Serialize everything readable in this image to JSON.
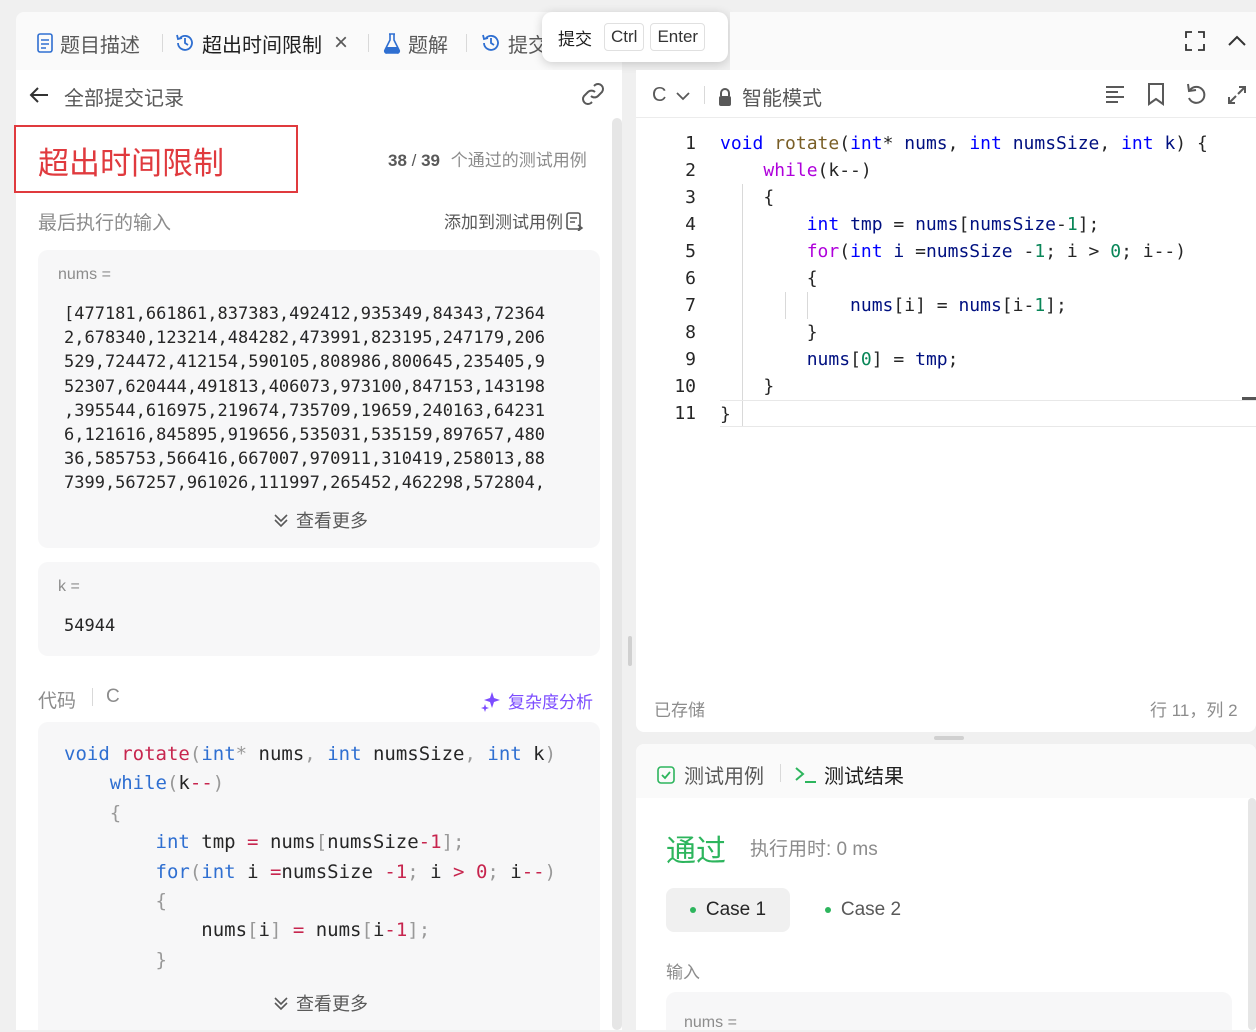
{
  "top_tabs": {
    "description": "题目描述",
    "tle": "超出时间限制",
    "solution": "题解",
    "submissions": "提交"
  },
  "submit_tooltip": {
    "label": "提交",
    "key1": "Ctrl",
    "key2": "Enter"
  },
  "left": {
    "back_label": "全部提交记录",
    "status": "超出时间限制",
    "passed": "38",
    "total": "39",
    "passed_suffix": "个通过的测试用例",
    "last_input_label": "最后执行的输入",
    "add_testcase": "添加到测试用例",
    "nums_label": "nums =",
    "nums_lines": [
      "[477181,661861,837383,492412,935349,84343,72364",
      "2,678340,123214,484282,473991,823195,247179,206",
      "529,724472,412154,590105,808986,800645,235405,9",
      "52307,620444,491813,406073,973100,847153,143198",
      ",395544,616975,219674,735709,19659,240163,64231",
      "6,121616,845895,919656,535031,535159,897657,480",
      "36,585753,566416,667007,970911,310419,258013,88",
      "7399,567257,961026,111997,265452,462298,572804,"
    ],
    "show_more": "查看更多",
    "k_label": "k =",
    "k_value": "54944",
    "code_label": "代码",
    "code_lang": "C",
    "complexity": "复杂度分析",
    "show_more_2": "查看更多"
  },
  "editor": {
    "lang": "C",
    "mode": "智能模式",
    "saved": "已存储",
    "cursor": "行 11，列 2",
    "line_numbers": [
      "1",
      "2",
      "3",
      "4",
      "5",
      "6",
      "7",
      "8",
      "9",
      "10",
      "11"
    ]
  },
  "bottom": {
    "tab_testcase": "测试用例",
    "tab_result": "测试结果",
    "result_status": "通过",
    "runtime": "执行用时: 0 ms",
    "case1": "Case 1",
    "case2": "Case 2",
    "input_label": "输入",
    "nums_label": "nums ="
  },
  "colors": {
    "error_red": "#e03a3e",
    "pass_green": "#2db55d",
    "accent_blue": "#2f6fd1",
    "purple": "#7c4dff"
  },
  "icons": [
    "document-icon",
    "history-icon",
    "close-icon",
    "flask-icon",
    "history-icon",
    "fullscreen-icon",
    "chevron-up-icon",
    "arrow-left-icon",
    "link-icon",
    "add-testcase-icon",
    "chevron-down-double-icon",
    "sparkle-icon",
    "chevron-down-icon",
    "lock-icon",
    "format-icon",
    "bookmark-icon",
    "undo-icon",
    "expand-icon",
    "checkbox-icon",
    "terminal-icon"
  ]
}
